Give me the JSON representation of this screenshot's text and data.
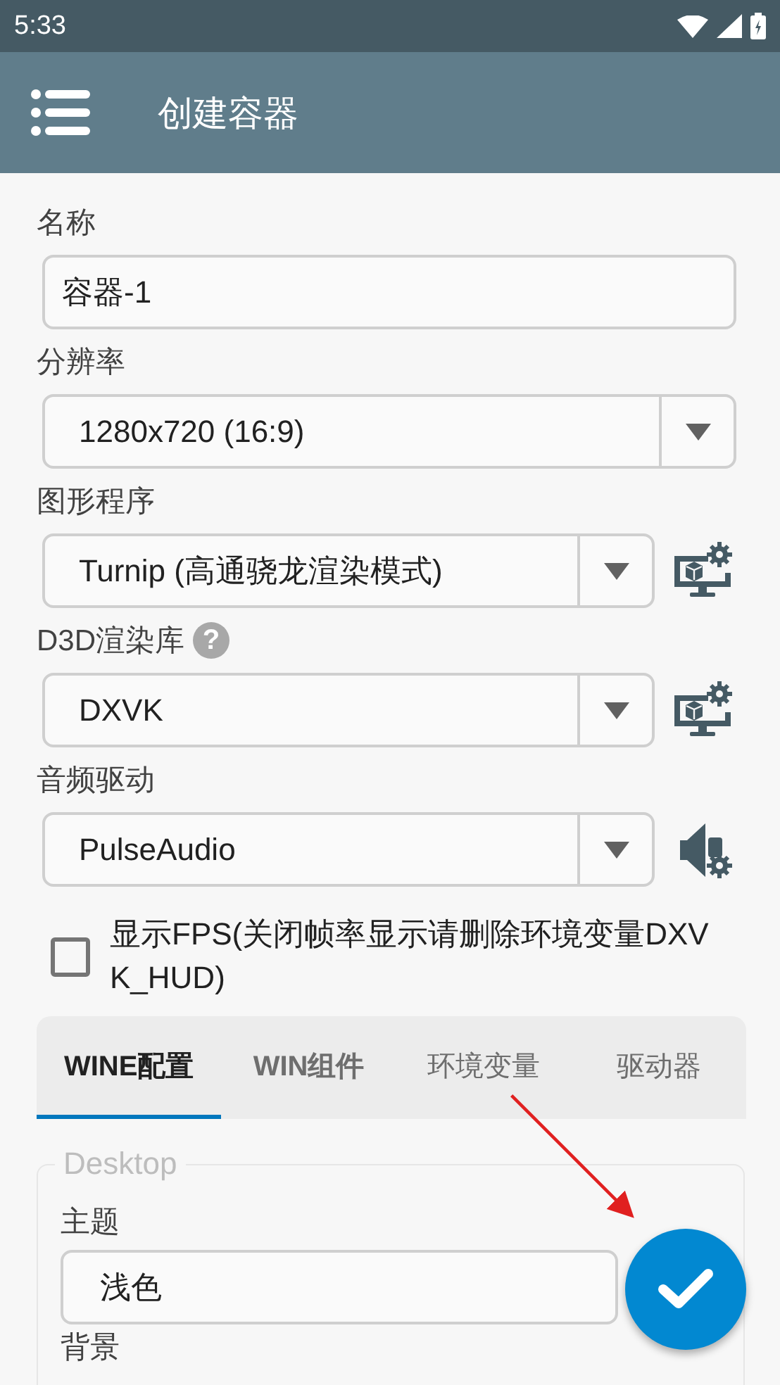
{
  "status_bar": {
    "time": "5:33"
  },
  "app_bar": {
    "title": "创建容器"
  },
  "fields": [
    {
      "kind": "text",
      "label": "名称",
      "value": "容器-1"
    },
    {
      "kind": "select",
      "label": "分辨率",
      "value": "1280x720 (16:9)"
    },
    {
      "kind": "display",
      "label": "图形程序",
      "value": "Turnip (高通骁龙渲染模式)"
    },
    {
      "kind": "display",
      "label": "D3D渲染库",
      "help": "?",
      "value": "DXVK"
    },
    {
      "kind": "audio",
      "label": "音频驱动",
      "value": "PulseAudio"
    }
  ],
  "show_fps": {
    "label": "显示FPS(关闭帧率显示请删除环境变量DXVK_HUD)",
    "checked": false
  },
  "tabs": [
    {
      "label": "WINE配置",
      "selected": true
    },
    {
      "label": "WIN组件",
      "selected": false
    },
    {
      "label": "环境变量",
      "selected": false
    },
    {
      "label": "驱动器",
      "selected": false
    }
  ],
  "desktop": {
    "legend": "Desktop",
    "theme_label": "主题",
    "theme_value": "浅色",
    "background_label": "背景"
  }
}
